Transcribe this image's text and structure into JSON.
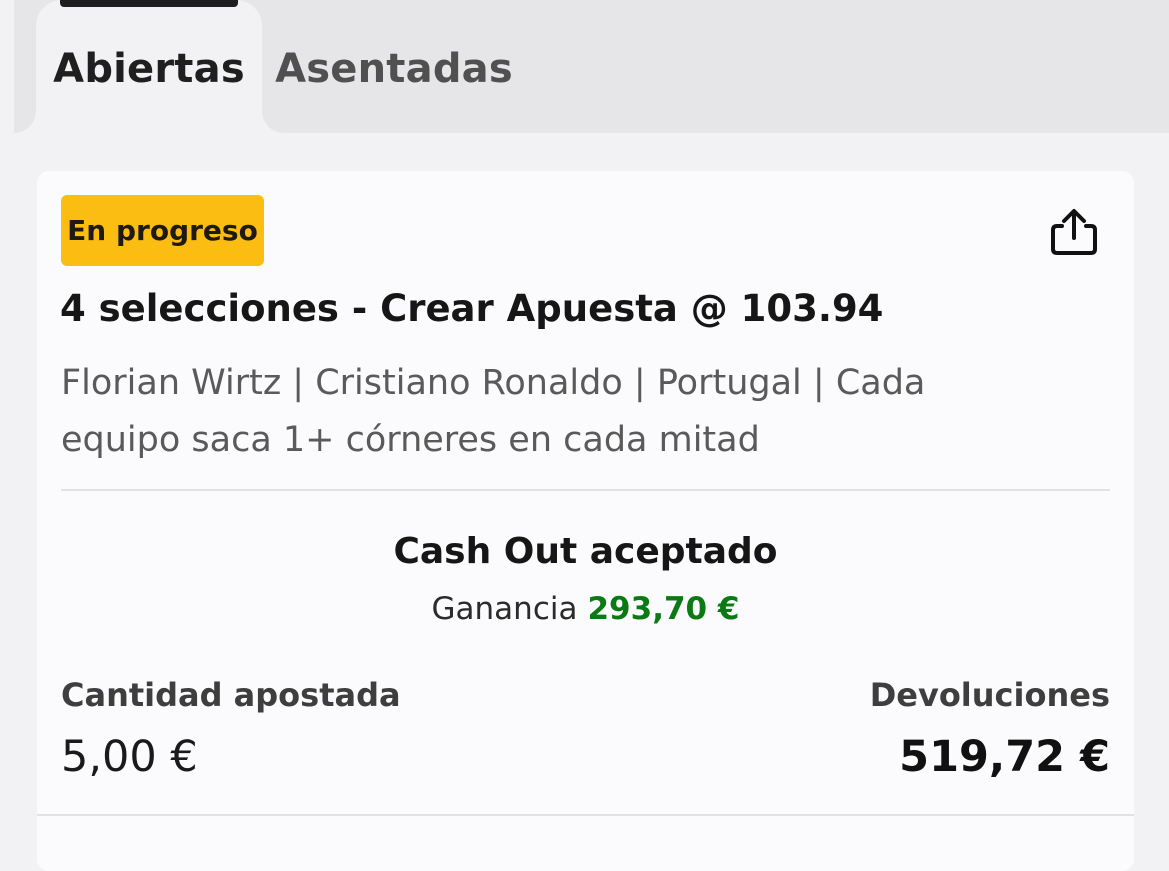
{
  "tabs": [
    {
      "label": "Abiertas",
      "active": true
    },
    {
      "label": "Asentadas",
      "active": false
    }
  ],
  "bet": {
    "status_badge": "En progreso",
    "status_color": "#fbbd12",
    "title": "4 selecciones - Crear Apuesta @ 103.94",
    "selections_line1": "Florian Wirtz | Cristiano Ronaldo | Portugal | Cada",
    "selections_line2": "equipo saca 1+ córneres en cada mitad",
    "share_icon": "share-icon",
    "cashout": {
      "title": "Cash Out aceptado",
      "profit_label": "Ganancia",
      "profit_value": "293,70 €",
      "profit_color": "#0b7a14"
    },
    "stake": {
      "label": "Cantidad apostada",
      "value": "5,00 €"
    },
    "returns": {
      "label": "Devoluciones",
      "value": "519,72 €"
    }
  }
}
